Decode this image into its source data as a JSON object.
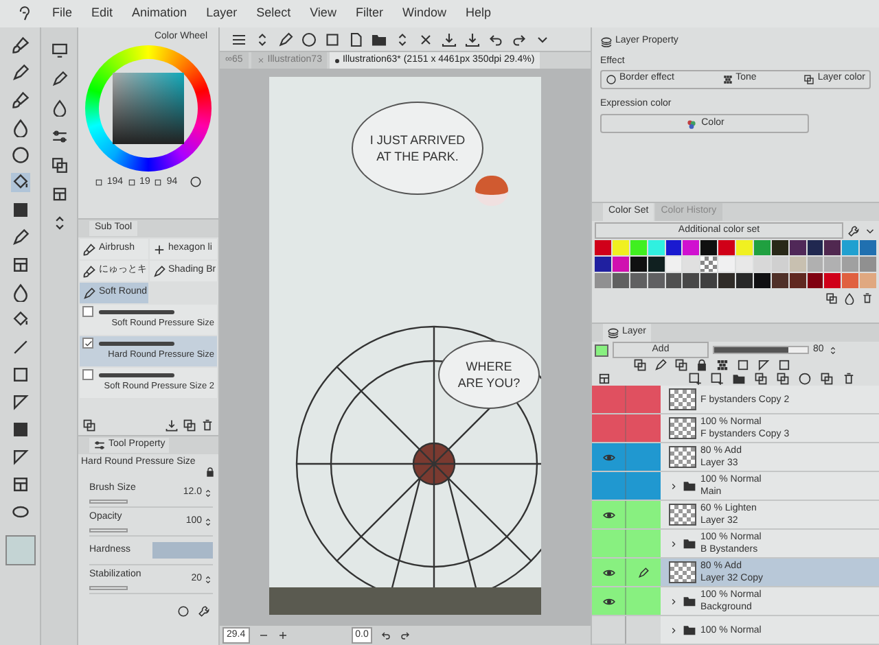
{
  "menu": [
    "File",
    "Edit",
    "Animation",
    "Layer",
    "Select",
    "View",
    "Filter",
    "Window",
    "Help"
  ],
  "doc_tabs": [
    {
      "label": "∞65",
      "selected": false
    },
    {
      "label": "Illustration73",
      "selected": false
    },
    {
      "label": "Illustration63* (2151 x 4461px 350dpi 29.4%)",
      "selected": true
    }
  ],
  "color_wheel": {
    "title": "Color Wheel",
    "values": [
      "194",
      "19",
      "94"
    ]
  },
  "sub_tool": {
    "title": "Sub Tool",
    "groups": [
      {
        "label": "Airbrush",
        "selected": false
      },
      {
        "label": "hexagon li",
        "selected": false
      },
      {
        "label": "にゅっとキ",
        "selected": false
      },
      {
        "label": "Shading Br",
        "selected": false
      },
      {
        "label": "Soft Round",
        "selected": true
      }
    ],
    "brushes": [
      {
        "label": "Soft Round Pressure Size",
        "checked": false
      },
      {
        "label": "Hard Round Pressure Size",
        "checked": true
      },
      {
        "label": "Soft Round Pressure Size 2",
        "checked": false
      }
    ]
  },
  "tool_property": {
    "title": "Tool Property",
    "brush_name": "Hard Round Pressure Size",
    "properties": [
      {
        "kind": "spinner",
        "label": "Brush Size",
        "value": "12.0"
      },
      {
        "kind": "spinner",
        "label": "Opacity",
        "value": "100"
      },
      {
        "kind": "preview",
        "label": "Hardness"
      },
      {
        "kind": "spinner",
        "label": "Stabilization",
        "value": "20"
      }
    ]
  },
  "canvas": {
    "bubbles": [
      "I JUST ARRIVED AT THE PARK.",
      "WHERE ARE YOU?"
    ],
    "zoom": "29.4",
    "rotation": "0.0"
  },
  "layer_property": {
    "title": "Layer Property",
    "effect_label": "Effect",
    "effects": [
      "Border effect",
      "Tone",
      "Layer color"
    ],
    "expression_label": "Expression color",
    "expression_value": "Color"
  },
  "color_set": {
    "tabs": [
      {
        "label": "Color Set",
        "selected": true
      },
      {
        "label": "Color History",
        "selected": false
      }
    ],
    "set_name": "Additional color set",
    "swatches": [
      {
        "kind": "solid",
        "color": "#d0001a"
      },
      {
        "kind": "solid",
        "color": "#f0f020"
      },
      {
        "kind": "solid",
        "color": "#40f020"
      },
      {
        "kind": "solid",
        "color": "#30f0e0"
      },
      {
        "kind": "solid",
        "color": "#1a1ad0"
      },
      {
        "kind": "solid",
        "color": "#d010d0"
      },
      {
        "kind": "solid",
        "color": "#101010"
      },
      {
        "kind": "solid",
        "color": "#d00018"
      },
      {
        "kind": "solid",
        "color": "#f0f021"
      },
      {
        "kind": "solid",
        "color": "#20a040"
      },
      {
        "kind": "solid",
        "color": "#282818"
      },
      {
        "kind": "solid",
        "color": "#502858"
      },
      {
        "kind": "solid",
        "color": "#202850"
      },
      {
        "kind": "solid",
        "color": "#502850"
      },
      {
        "kind": "solid",
        "color": "#20a0d0"
      },
      {
        "kind": "solid",
        "color": "#2070b0"
      },
      {
        "kind": "solid",
        "color": "#2020a0"
      },
      {
        "kind": "solid",
        "color": "#d010b0"
      },
      {
        "kind": "solid",
        "color": "#101011"
      },
      {
        "kind": "solid",
        "color": "#102020"
      },
      {
        "kind": "solid",
        "color": "#f0f0f0"
      },
      {
        "kind": "solid",
        "color": "#e0e0e0"
      },
      {
        "kind": "transparent"
      },
      {
        "kind": "solid",
        "color": "#f0f0f1"
      },
      {
        "kind": "solid",
        "color": "#e8e8e8"
      },
      {
        "kind": "solid",
        "color": "#d8d8d8"
      },
      {
        "kind": "solid",
        "color": "#d0d0d0"
      },
      {
        "kind": "solid",
        "color": "#c8c0b0"
      },
      {
        "kind": "solid",
        "color": "#b0b0b0"
      },
      {
        "kind": "solid",
        "color": "#b0b0b1"
      },
      {
        "kind": "solid",
        "color": "#a0a0a0"
      },
      {
        "kind": "solid",
        "color": "#909090"
      },
      {
        "kind": "solid",
        "color": "#909091"
      },
      {
        "kind": "solid",
        "color": "#606060"
      },
      {
        "kind": "solid",
        "color": "#606061"
      },
      {
        "kind": "solid",
        "color": "#606062"
      },
      {
        "kind": "solid",
        "color": "#505050"
      },
      {
        "kind": "solid",
        "color": "#484848"
      },
      {
        "kind": "solid",
        "color": "#404040"
      },
      {
        "kind": "solid",
        "color": "#302c28"
      },
      {
        "kind": "solid",
        "color": "#282828"
      },
      {
        "kind": "solid",
        "color": "#101012"
      },
      {
        "kind": "solid",
        "color": "#503028"
      },
      {
        "kind": "solid",
        "color": "#602820"
      },
      {
        "kind": "solid",
        "color": "#800010"
      },
      {
        "kind": "solid",
        "color": "#d00019"
      },
      {
        "kind": "solid",
        "color": "#e06040"
      },
      {
        "kind": "solid",
        "color": "#e0a880"
      }
    ]
  },
  "layer": {
    "title": "Layer",
    "blend_mode": "Add",
    "opacity": "80",
    "level": 0.8,
    "layers": [
      {
        "kind": "layer",
        "name": "F bystanders Copy 2",
        "color": "#e05060",
        "visible": false,
        "selected": false
      },
      {
        "kind": "layer",
        "mode": "100 % Normal",
        "name": "F bystanders Copy 3",
        "color": "#e05060",
        "visible": false,
        "selected": false
      },
      {
        "kind": "layer",
        "mode": "80 % Add",
        "name": "Layer 33",
        "color": "#2098d0",
        "visible": true,
        "selected": false
      },
      {
        "kind": "folder",
        "mode": "100 % Normal",
        "name": "Main",
        "color": "#2098d0",
        "visible": false,
        "selected": false
      },
      {
        "kind": "layer",
        "mode": "60 % Lighten",
        "name": "Layer 32",
        "color": "#88f080",
        "visible": true,
        "selected": false
      },
      {
        "kind": "folder",
        "mode": "100 % Normal",
        "name": "B Bystanders",
        "color": "#88f080",
        "visible": false,
        "selected": false
      },
      {
        "kind": "layer",
        "mode": "80 % Add",
        "name": "Layer 32 Copy",
        "color": "#88f080",
        "visible": true,
        "selected": true
      },
      {
        "kind": "folder",
        "mode": "100 % Normal",
        "name": "Background",
        "color": "#88f080",
        "visible": true,
        "selected": false
      },
      {
        "kind": "folder",
        "mode": "100 % Normal",
        "color": "#d6d8d8",
        "visible": false,
        "selected": false
      }
    ]
  }
}
